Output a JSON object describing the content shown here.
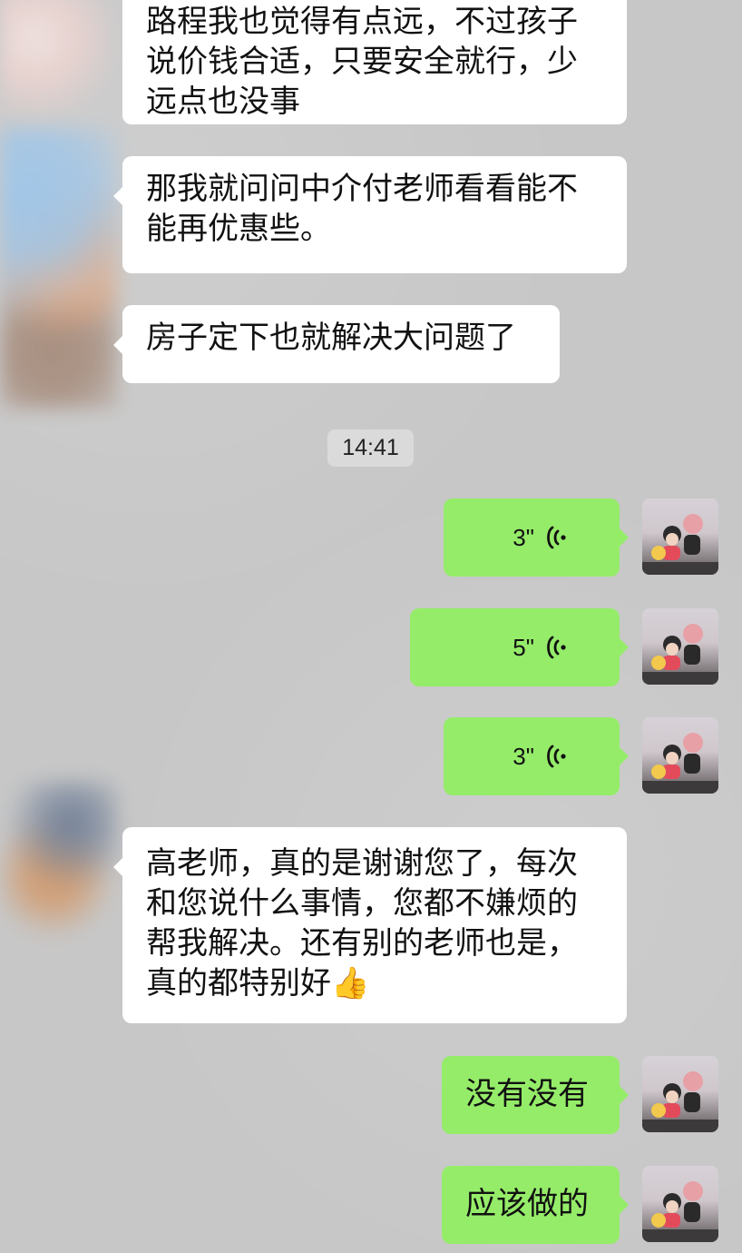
{
  "colors": {
    "background": "#c7c7c7",
    "incoming_bubble": "#ffffff",
    "outgoing_bubble": "#95ec69",
    "time_pill": "rgba(255,255,255,0.33)"
  },
  "chat": {
    "timestamp": "14:41",
    "messages": [
      {
        "direction": "in",
        "text": "路程我也觉得有点远，不过孩子\n说价钱合适，只要安全就行，少\n远点也没事"
      },
      {
        "direction": "in",
        "text": "那我就问问中介付老师看看能不\n能再优惠些。"
      },
      {
        "direction": "in",
        "text": "房子定下也就解决大问题了"
      },
      {
        "direction": "out",
        "type": "voice",
        "duration": "3\""
      },
      {
        "direction": "out",
        "type": "voice",
        "duration": "5\""
      },
      {
        "direction": "out",
        "type": "voice",
        "duration": "3\""
      },
      {
        "direction": "in",
        "text": "高老师，真的是谢谢您了，每次\n和您说什么事情，您都不嫌烦的\n帮我解决。还有别的老师也是，\n真的都特别好👍"
      },
      {
        "direction": "out",
        "text": "没有没有"
      },
      {
        "direction": "out",
        "text": "应该做的"
      }
    ]
  },
  "icons": {
    "voice": "voice-wave-icon",
    "avatar_left": "blurred-avatar",
    "avatar_right": "figurine-avatar"
  }
}
